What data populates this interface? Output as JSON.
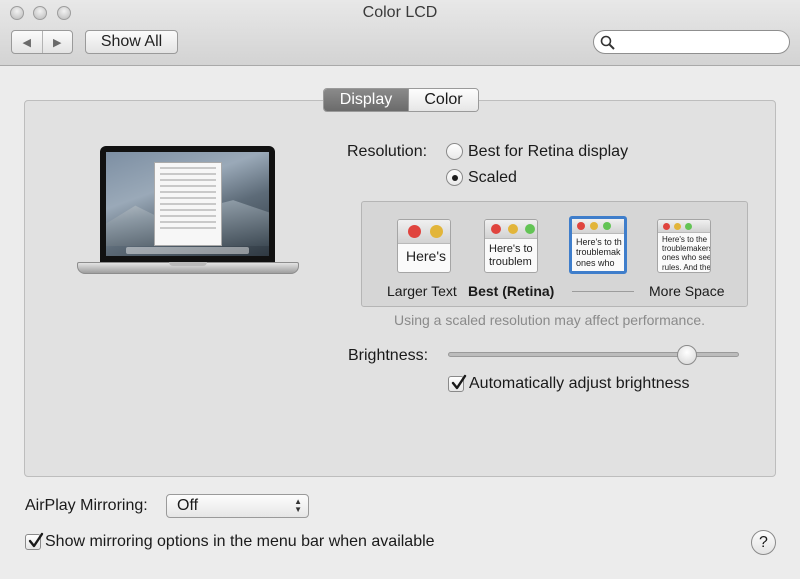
{
  "window": {
    "title": "Color LCD",
    "nav_back": "◀",
    "nav_forward": "▶",
    "show_all": "Show All",
    "search_placeholder": ""
  },
  "tabs": [
    {
      "label": "Display",
      "selected": true
    },
    {
      "label": "Color",
      "selected": false
    }
  ],
  "resolution": {
    "label": "Resolution:",
    "options": [
      {
        "label": "Best for Retina display",
        "selected": false
      },
      {
        "label": "Scaled",
        "selected": true
      }
    ],
    "scaled_options": [
      {
        "label": "Larger Text",
        "preview_text": "Here's",
        "selected": false
      },
      {
        "label": "Best (Retina)",
        "preview_text": "Here's to\ntroublem",
        "selected": false
      },
      {
        "label": "",
        "preview_text": "Here's to th\ntroublemak\nones who",
        "selected": true
      },
      {
        "label": "More Space",
        "preview_text": "Here's to the\ntroublemakers.\nones who see\nrules. And they",
        "selected": false
      }
    ],
    "note": "Using a scaled resolution may affect performance."
  },
  "brightness": {
    "label": "Brightness:",
    "value": 0.81,
    "auto_label": "Automatically adjust brightness",
    "auto_checked": true
  },
  "airplay": {
    "label": "AirPlay Mirroring:",
    "value": "Off",
    "show_menu_label": "Show mirroring options in the menu bar when available",
    "show_menu_checked": true
  },
  "help": "?"
}
